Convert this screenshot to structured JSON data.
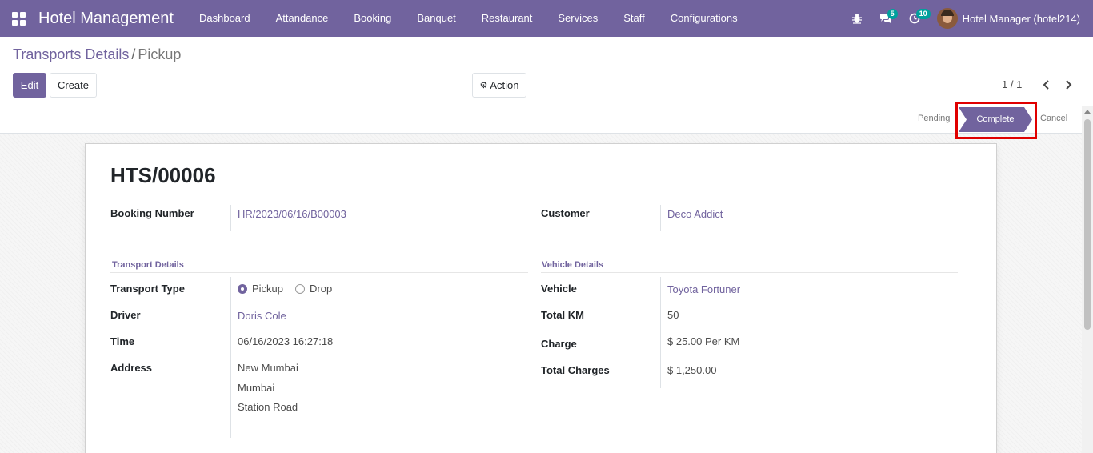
{
  "navbar": {
    "app_title": "Hotel Management",
    "menu": [
      "Dashboard",
      "Attandance",
      "Booking",
      "Banquet",
      "Restaurant",
      "Services",
      "Staff",
      "Configurations"
    ],
    "messages_count": "5",
    "activities_count": "10",
    "user_name": "Hotel Manager (hotel214)"
  },
  "breadcrumb": {
    "parent": "Transports Details",
    "separator": "/",
    "current": "Pickup"
  },
  "buttons": {
    "edit": "Edit",
    "create": "Create",
    "action": "Action"
  },
  "pager": {
    "value": "1 / 1"
  },
  "statusbar": {
    "stages": [
      "Pending",
      "Complete",
      "Cancel"
    ],
    "active": "Complete"
  },
  "record": {
    "title": "HTS/00006",
    "booking_number_label": "Booking Number",
    "booking_number": "HR/2023/06/16/B00003",
    "customer_label": "Customer",
    "customer": "Deco Addict",
    "transport_section": "Transport Details",
    "transport_type_label": "Transport Type",
    "transport_type_options": [
      "Pickup",
      "Drop"
    ],
    "transport_type_selected": "Pickup",
    "driver_label": "Driver",
    "driver": "Doris Cole",
    "time_label": "Time",
    "time": "06/16/2023 16:27:18",
    "address_label": "Address",
    "address_lines": [
      "New Mumbai",
      "Mumbai",
      "Station Road"
    ],
    "vehicle_section": "Vehicle Details",
    "vehicle_label": "Vehicle",
    "vehicle": "Toyota Fortuner",
    "total_km_label": "Total KM",
    "total_km": "50",
    "charge_label": "Charge",
    "charge": "$ 25.00 Per KM",
    "total_charges_label": "Total Charges",
    "total_charges": "$ 1,250.00"
  },
  "colors": {
    "brand": "#71639e",
    "badge": "#00a09d",
    "highlight": "#e00000"
  }
}
